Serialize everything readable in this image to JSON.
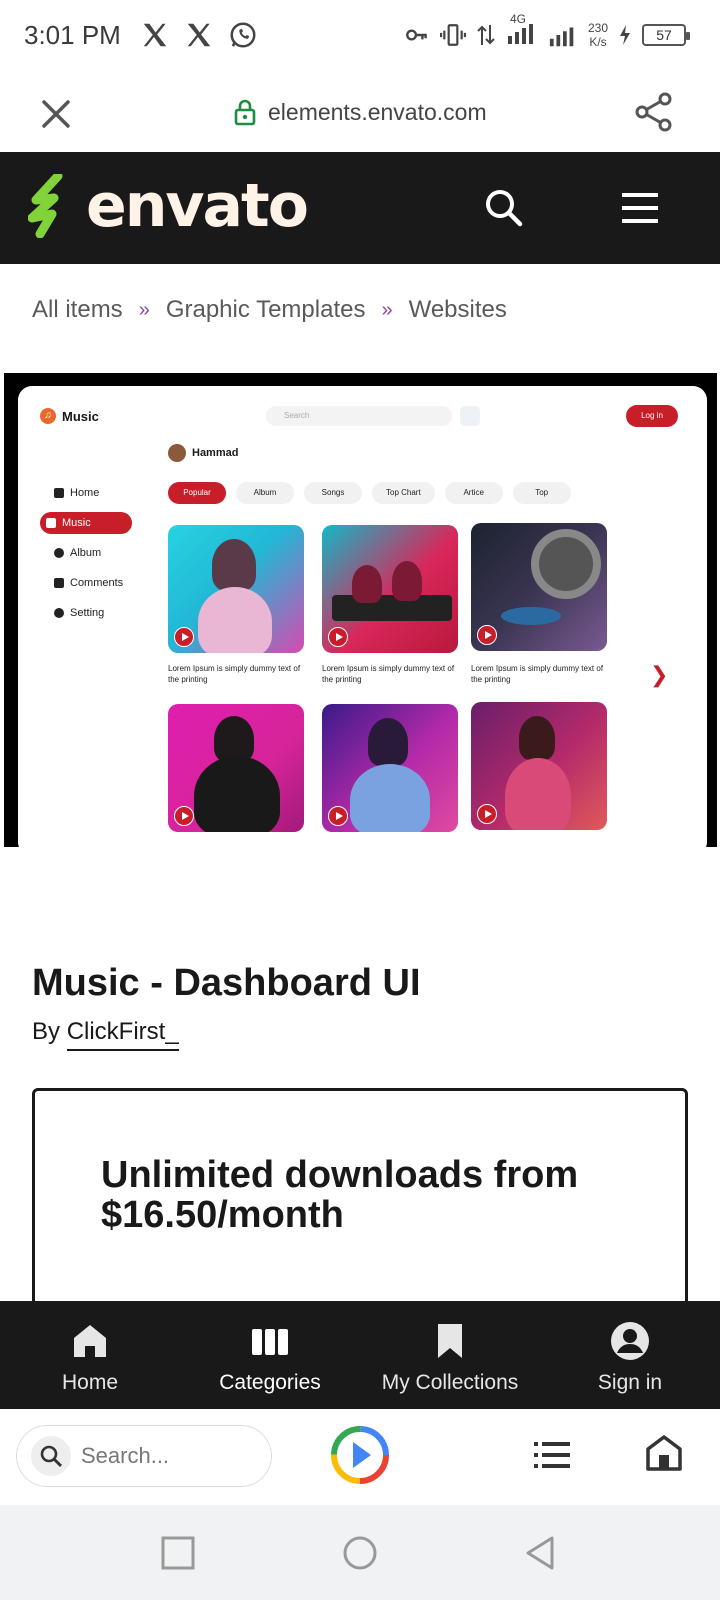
{
  "status_bar": {
    "time": "3:01 PM",
    "network_type": "4G",
    "speed_value": "230",
    "speed_unit": "K/s",
    "battery": "57"
  },
  "browser": {
    "url": "elements.envato.com",
    "search_placeholder": "Search..."
  },
  "site": {
    "logo_text": "envato",
    "brand_green": "#82d33a",
    "header_bg": "#191919"
  },
  "breadcrumb": [
    {
      "label": "All items"
    },
    {
      "label": "Graphic Templates"
    },
    {
      "label": "Websites"
    }
  ],
  "breadcrumb_separator": "»",
  "preview": {
    "app_name": "Music",
    "search_placeholder": "Search",
    "login_label": "Log in",
    "user_name": "Hammad",
    "sidebar": [
      {
        "label": "Home",
        "active": false
      },
      {
        "label": "Music",
        "active": true
      },
      {
        "label": "Album",
        "active": false
      },
      {
        "label": "Comments",
        "active": false
      },
      {
        "label": "Setting",
        "active": false
      }
    ],
    "tabs": [
      "Popular",
      "Album",
      "Songs",
      "Top Chart",
      "Artice",
      "Top"
    ],
    "card_caption": "Lorem Ipsum is simply dummy text of the printing",
    "accent": "#c81e2a"
  },
  "item": {
    "title": "Music - Dashboard UI",
    "by_label": "By",
    "author": "ClickFirst_"
  },
  "promo": {
    "text": "Unlimited downloads from $16.50/month"
  },
  "bottom_nav": [
    {
      "label": "Home",
      "icon": "home-icon"
    },
    {
      "label": "Categories",
      "icon": "categories-icon"
    },
    {
      "label": "My Collections",
      "icon": "bookmark-icon"
    },
    {
      "label": "Sign in",
      "icon": "account-icon"
    }
  ]
}
